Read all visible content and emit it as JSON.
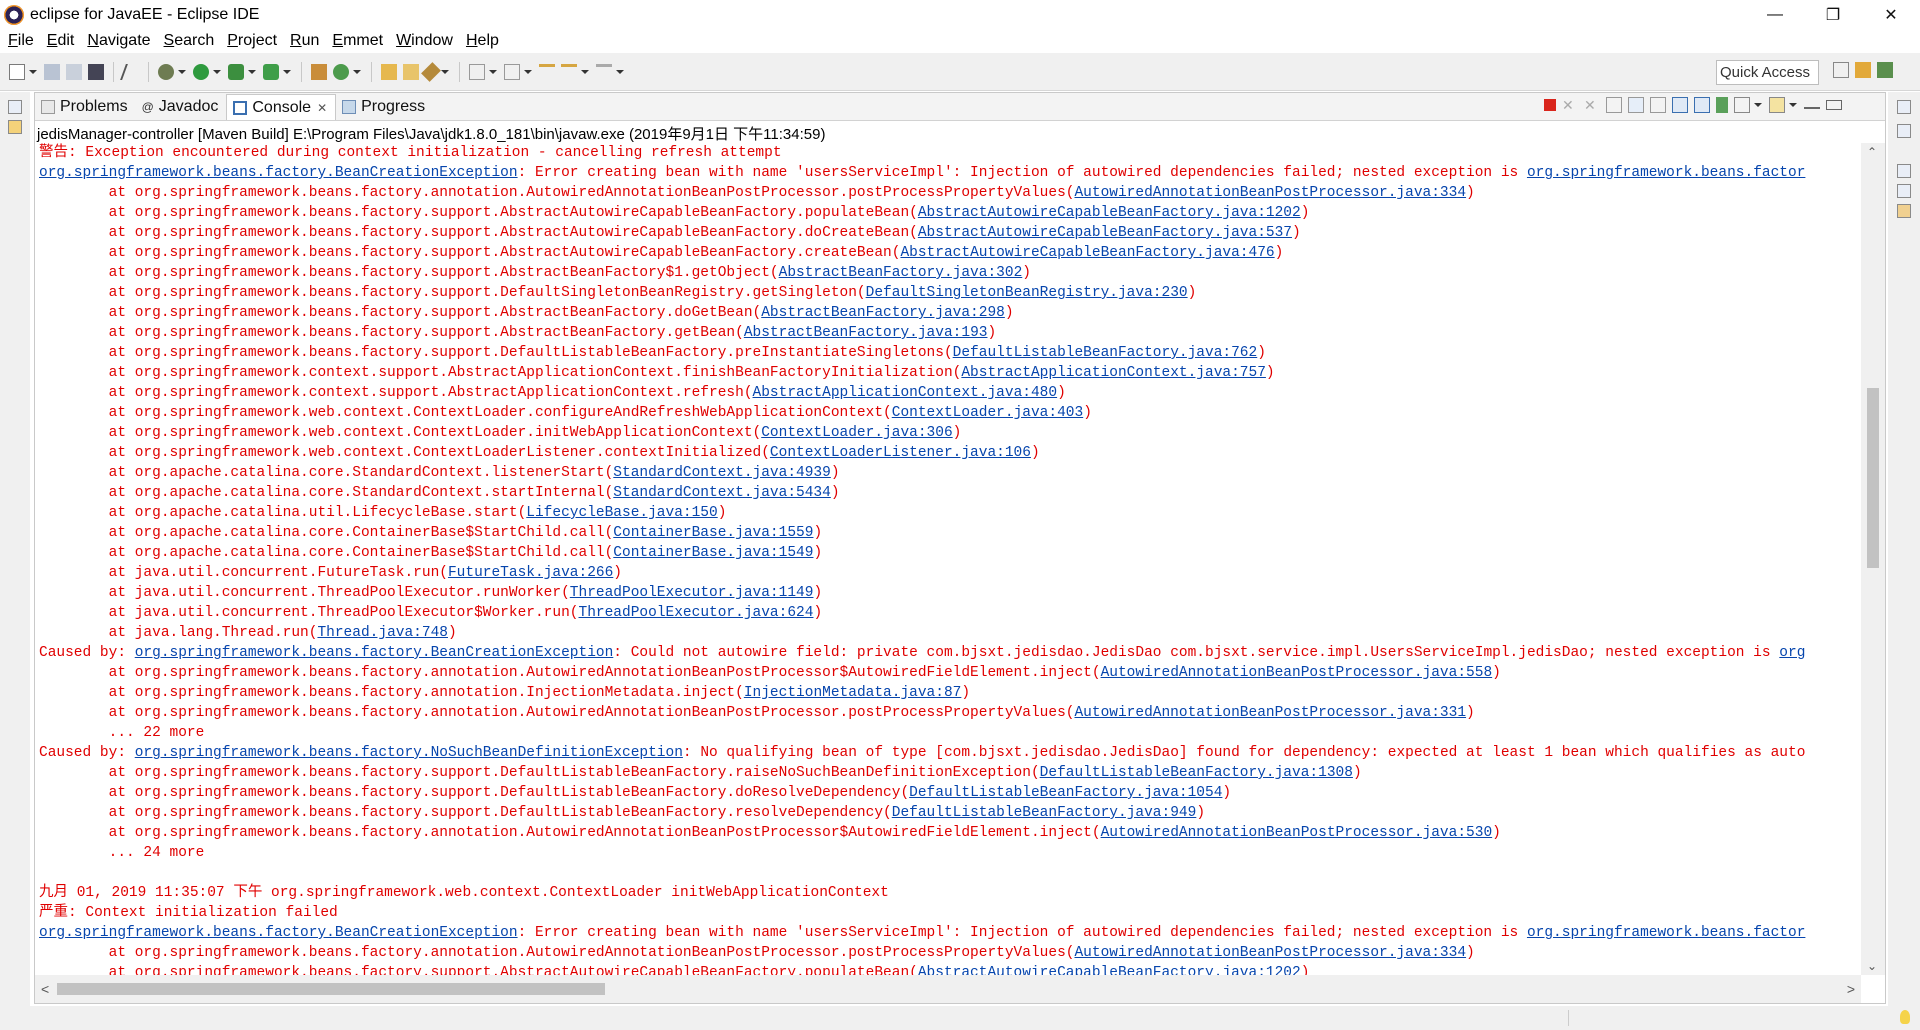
{
  "window": {
    "title": "eclipse for JavaEE - Eclipse IDE",
    "controls": [
      "—",
      "❐",
      "✕"
    ]
  },
  "menubar": [
    "File",
    "Edit",
    "Navigate",
    "Search",
    "Project",
    "Run",
    "Emmet",
    "Window",
    "Help"
  ],
  "toolbar": {
    "quick_access": "Quick Access"
  },
  "tabs": [
    {
      "label": "Problems",
      "icon": "problems-icon"
    },
    {
      "label": "Javadoc",
      "icon": "javadoc-icon"
    },
    {
      "label": "Console",
      "icon": "console-icon",
      "active": true,
      "close": "✕"
    },
    {
      "label": "Progress",
      "icon": "progress-icon"
    }
  ],
  "console": {
    "header": "jedisManager-controller [Maven Build] E:\\Program Files\\Java\\jdk1.8.0_181\\bin\\javaw.exe (2019年9月1日 下午11:34:59)",
    "lines": [
      [
        {
          "t": "警告: Exception encountered during context initialization - cancelling refresh attempt"
        }
      ],
      [
        {
          "t": "org.springframework.beans.factory.BeanCreationException",
          "link": true
        },
        {
          "t": ": Error creating bean with name 'usersServiceImpl': Injection of autowired dependencies failed; nested exception is "
        },
        {
          "t": "org.springframework.beans.factor",
          "link": true
        }
      ],
      [
        {
          "t": "\tat org.springframework.beans.factory.annotation.AutowiredAnnotationBeanPostProcessor.postProcessPropertyValues("
        },
        {
          "t": "AutowiredAnnotationBeanPostProcessor.java:334",
          "link": true
        },
        {
          "t": ")"
        }
      ],
      [
        {
          "t": "\tat org.springframework.beans.factory.support.AbstractAutowireCapableBeanFactory.populateBean("
        },
        {
          "t": "AbstractAutowireCapableBeanFactory.java:1202",
          "link": true
        },
        {
          "t": ")"
        }
      ],
      [
        {
          "t": "\tat org.springframework.beans.factory.support.AbstractAutowireCapableBeanFactory.doCreateBean("
        },
        {
          "t": "AbstractAutowireCapableBeanFactory.java:537",
          "link": true
        },
        {
          "t": ")"
        }
      ],
      [
        {
          "t": "\tat org.springframework.beans.factory.support.AbstractAutowireCapableBeanFactory.createBean("
        },
        {
          "t": "AbstractAutowireCapableBeanFactory.java:476",
          "link": true
        },
        {
          "t": ")"
        }
      ],
      [
        {
          "t": "\tat org.springframework.beans.factory.support.AbstractBeanFactory$1.getObject("
        },
        {
          "t": "AbstractBeanFactory.java:302",
          "link": true
        },
        {
          "t": ")"
        }
      ],
      [
        {
          "t": "\tat org.springframework.beans.factory.support.DefaultSingletonBeanRegistry.getSingleton("
        },
        {
          "t": "DefaultSingletonBeanRegistry.java:230",
          "link": true
        },
        {
          "t": ")"
        }
      ],
      [
        {
          "t": "\tat org.springframework.beans.factory.support.AbstractBeanFactory.doGetBean("
        },
        {
          "t": "AbstractBeanFactory.java:298",
          "link": true
        },
        {
          "t": ")"
        }
      ],
      [
        {
          "t": "\tat org.springframework.beans.factory.support.AbstractBeanFactory.getBean("
        },
        {
          "t": "AbstractBeanFactory.java:193",
          "link": true
        },
        {
          "t": ")"
        }
      ],
      [
        {
          "t": "\tat org.springframework.beans.factory.support.DefaultListableBeanFactory.preInstantiateSingletons("
        },
        {
          "t": "DefaultListableBeanFactory.java:762",
          "link": true
        },
        {
          "t": ")"
        }
      ],
      [
        {
          "t": "\tat org.springframework.context.support.AbstractApplicationContext.finishBeanFactoryInitialization("
        },
        {
          "t": "AbstractApplicationContext.java:757",
          "link": true
        },
        {
          "t": ")"
        }
      ],
      [
        {
          "t": "\tat org.springframework.context.support.AbstractApplicationContext.refresh("
        },
        {
          "t": "AbstractApplicationContext.java:480",
          "link": true
        },
        {
          "t": ")"
        }
      ],
      [
        {
          "t": "\tat org.springframework.web.context.ContextLoader.configureAndRefreshWebApplicationContext("
        },
        {
          "t": "ContextLoader.java:403",
          "link": true
        },
        {
          "t": ")"
        }
      ],
      [
        {
          "t": "\tat org.springframework.web.context.ContextLoader.initWebApplicationContext("
        },
        {
          "t": "ContextLoader.java:306",
          "link": true
        },
        {
          "t": ")"
        }
      ],
      [
        {
          "t": "\tat org.springframework.web.context.ContextLoaderListener.contextInitialized("
        },
        {
          "t": "ContextLoaderListener.java:106",
          "link": true
        },
        {
          "t": ")"
        }
      ],
      [
        {
          "t": "\tat org.apache.catalina.core.StandardContext.listenerStart("
        },
        {
          "t": "StandardContext.java:4939",
          "link": true
        },
        {
          "t": ")"
        }
      ],
      [
        {
          "t": "\tat org.apache.catalina.core.StandardContext.startInternal("
        },
        {
          "t": "StandardContext.java:5434",
          "link": true
        },
        {
          "t": ")"
        }
      ],
      [
        {
          "t": "\tat org.apache.catalina.util.LifecycleBase.start("
        },
        {
          "t": "LifecycleBase.java:150",
          "link": true
        },
        {
          "t": ")"
        }
      ],
      [
        {
          "t": "\tat org.apache.catalina.core.ContainerBase$StartChild.call("
        },
        {
          "t": "ContainerBase.java:1559",
          "link": true
        },
        {
          "t": ")"
        }
      ],
      [
        {
          "t": "\tat org.apache.catalina.core.ContainerBase$StartChild.call("
        },
        {
          "t": "ContainerBase.java:1549",
          "link": true
        },
        {
          "t": ")"
        }
      ],
      [
        {
          "t": "\tat java.util.concurrent.FutureTask.run("
        },
        {
          "t": "FutureTask.java:266",
          "link": true
        },
        {
          "t": ")"
        }
      ],
      [
        {
          "t": "\tat java.util.concurrent.ThreadPoolExecutor.runWorker("
        },
        {
          "t": "ThreadPoolExecutor.java:1149",
          "link": true
        },
        {
          "t": ")"
        }
      ],
      [
        {
          "t": "\tat java.util.concurrent.ThreadPoolExecutor$Worker.run("
        },
        {
          "t": "ThreadPoolExecutor.java:624",
          "link": true
        },
        {
          "t": ")"
        }
      ],
      [
        {
          "t": "\tat java.lang.Thread.run("
        },
        {
          "t": "Thread.java:748",
          "link": true
        },
        {
          "t": ")"
        }
      ],
      [
        {
          "t": "Caused by: "
        },
        {
          "t": "org.springframework.beans.factory.BeanCreationException",
          "link": true
        },
        {
          "t": ": Could not autowire field: private com.bjsxt.jedisdao.JedisDao com.bjsxt.service.impl.UsersServiceImpl.jedisDao; nested exception is "
        },
        {
          "t": "org",
          "link": true
        }
      ],
      [
        {
          "t": "\tat org.springframework.beans.factory.annotation.AutowiredAnnotationBeanPostProcessor$AutowiredFieldElement.inject("
        },
        {
          "t": "AutowiredAnnotationBeanPostProcessor.java:558",
          "link": true
        },
        {
          "t": ")"
        }
      ],
      [
        {
          "t": "\tat org.springframework.beans.factory.annotation.InjectionMetadata.inject("
        },
        {
          "t": "InjectionMetadata.java:87",
          "link": true
        },
        {
          "t": ")"
        }
      ],
      [
        {
          "t": "\tat org.springframework.beans.factory.annotation.AutowiredAnnotationBeanPostProcessor.postProcessPropertyValues("
        },
        {
          "t": "AutowiredAnnotationBeanPostProcessor.java:331",
          "link": true
        },
        {
          "t": ")"
        }
      ],
      [
        {
          "t": "\t... 22 more"
        }
      ],
      [
        {
          "t": "Caused by: "
        },
        {
          "t": "org.springframework.beans.factory.NoSuchBeanDefinitionException",
          "link": true
        },
        {
          "t": ": No qualifying bean of type [com.bjsxt.jedisdao.JedisDao] found for dependency: expected at least 1 bean which qualifies as auto"
        }
      ],
      [
        {
          "t": "\tat org.springframework.beans.factory.support.DefaultListableBeanFactory.raiseNoSuchBeanDefinitionException("
        },
        {
          "t": "DefaultListableBeanFactory.java:1308",
          "link": true
        },
        {
          "t": ")"
        }
      ],
      [
        {
          "t": "\tat org.springframework.beans.factory.support.DefaultListableBeanFactory.doResolveDependency("
        },
        {
          "t": "DefaultListableBeanFactory.java:1054",
          "link": true
        },
        {
          "t": ")"
        }
      ],
      [
        {
          "t": "\tat org.springframework.beans.factory.support.DefaultListableBeanFactory.resolveDependency("
        },
        {
          "t": "DefaultListableBeanFactory.java:949",
          "link": true
        },
        {
          "t": ")"
        }
      ],
      [
        {
          "t": "\tat org.springframework.beans.factory.annotation.AutowiredAnnotationBeanPostProcessor$AutowiredFieldElement.inject("
        },
        {
          "t": "AutowiredAnnotationBeanPostProcessor.java:530",
          "link": true
        },
        {
          "t": ")"
        }
      ],
      [
        {
          "t": "\t... 24 more"
        }
      ],
      [
        {
          "t": ""
        }
      ],
      [
        {
          "t": "九月 01, 2019 11:35:07 下午 org.springframework.web.context.ContextLoader initWebApplicationContext"
        }
      ],
      [
        {
          "t": "严重: Context initialization failed"
        }
      ],
      [
        {
          "t": "org.springframework.beans.factory.BeanCreationException",
          "link": true
        },
        {
          "t": ": Error creating bean with name 'usersServiceImpl': Injection of autowired dependencies failed; nested exception is "
        },
        {
          "t": "org.springframework.beans.factor",
          "link": true
        }
      ],
      [
        {
          "t": "\tat org.springframework.beans.factory.annotation.AutowiredAnnotationBeanPostProcessor.postProcessPropertyValues("
        },
        {
          "t": "AutowiredAnnotationBeanPostProcessor.java:334",
          "link": true
        },
        {
          "t": ")"
        }
      ],
      [
        {
          "t": "\tat org.springframework.beans.factory.support.AbstractAutowireCapableBeanFactory.populateBean("
        },
        {
          "t": "AbstractAutowireCapableBeanFactory.java:1202",
          "link": true
        },
        {
          "t": ")"
        }
      ]
    ]
  },
  "colors": {
    "error_text": "#e00000",
    "link": "#0645ad",
    "toolbar_bg": "#f0f0f0"
  }
}
